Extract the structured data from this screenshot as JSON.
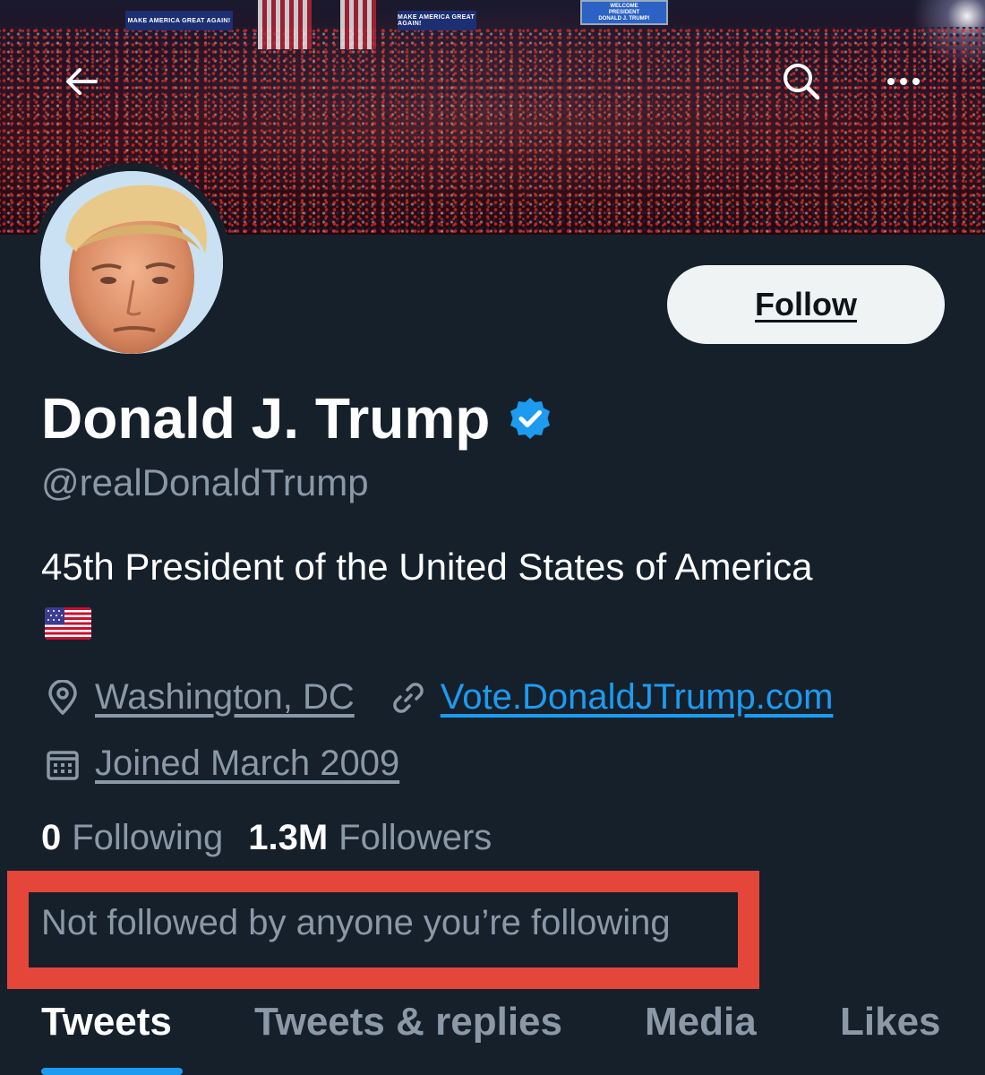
{
  "banner": {
    "signs": [
      "MAKE AMERICA GREAT AGAIN!",
      "MAKE AMERICA GREAT AGAIN!"
    ],
    "screen_lines": [
      "WELCOME",
      "PRESIDENT",
      "DONALD J. TRUMP!"
    ]
  },
  "nav": {
    "back_icon": "arrow-left-icon",
    "search_icon": "search-icon",
    "more_icon": "more-horizontal-icon"
  },
  "profile": {
    "avatar_icon": "avatar",
    "follow_label": "Follow",
    "display_name": "Donald J. Trump",
    "verified_icon": "verified-badge-icon",
    "handle": "@realDonaldTrump",
    "bio": "45th President of the United States of America",
    "bio_emoji": "us-flag-emoji",
    "location": "Washington, DC",
    "website": "Vote.DonaldJTrump.com",
    "joined": "Joined March 2009",
    "following_count": "0",
    "following_label": "Following",
    "followers_count": "1.3M",
    "followers_label": "Followers",
    "followed_by_text": "Not followed by anyone you’re following"
  },
  "tabs": [
    "Tweets",
    "Tweets & replies",
    "Media",
    "Likes"
  ],
  "active_tab": "Tweets",
  "colors": {
    "background": "#15202b",
    "accent": "#1d9bf0",
    "secondary_text": "#8b98a5",
    "highlight_box": "#e4463a"
  }
}
